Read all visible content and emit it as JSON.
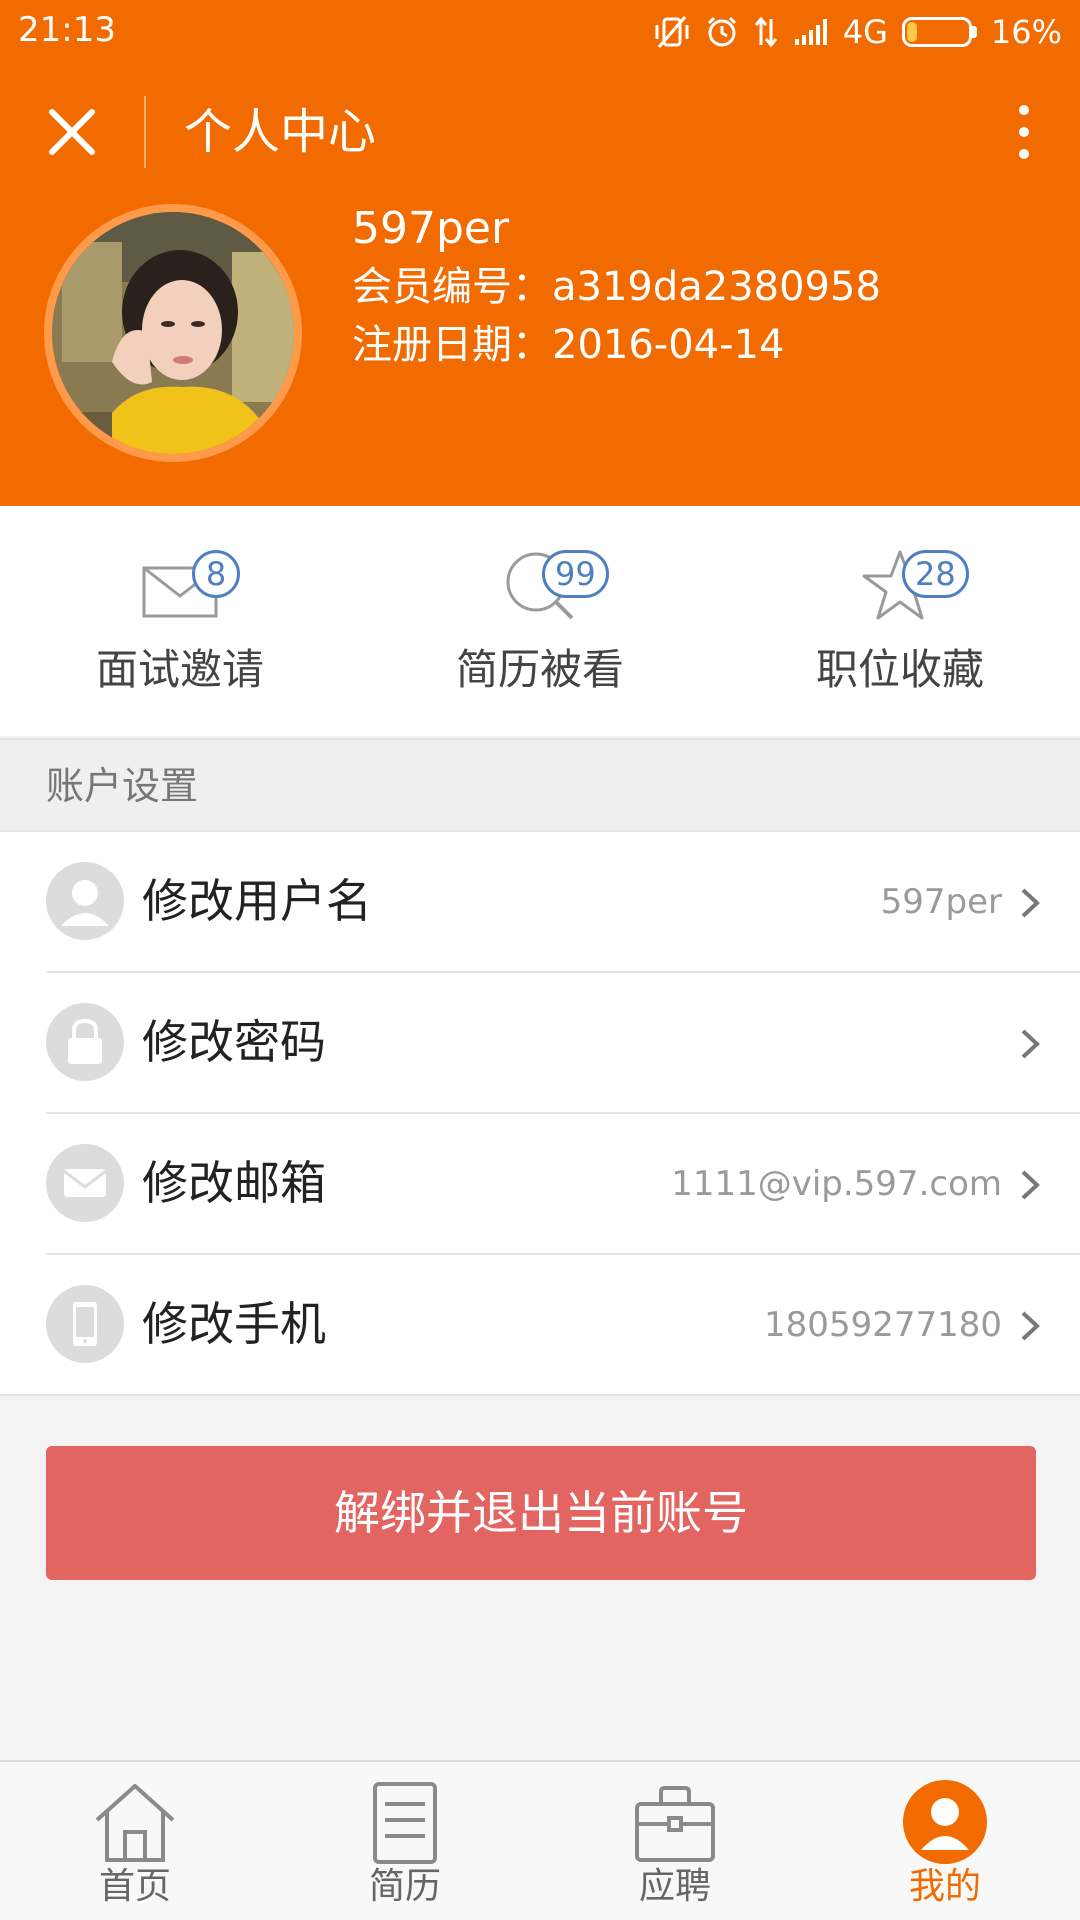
{
  "status_bar": {
    "time": "21:13",
    "network": "4G",
    "battery": "16%",
    "battery_level": 0.16
  },
  "app_bar": {
    "title": "个人中心"
  },
  "profile": {
    "username": "597per",
    "member_id_line": "会员编号：a319da2380958",
    "register_date_line": "注册日期：2016-04-14"
  },
  "stats": [
    {
      "label": "面试邀请",
      "count": "8",
      "icon": "envelope-icon"
    },
    {
      "label": "简历被看",
      "count": "99",
      "icon": "search-icon"
    },
    {
      "label": "职位收藏",
      "count": "28",
      "icon": "star-icon"
    }
  ],
  "account_section": {
    "title": "账户设置"
  },
  "settings": [
    {
      "label": "修改用户名",
      "value": "597per",
      "icon": "user-icon"
    },
    {
      "label": "修改密码",
      "value": "",
      "icon": "lock-icon"
    },
    {
      "label": "修改邮箱",
      "value": "1111@vip.597.com",
      "icon": "mail-icon"
    },
    {
      "label": "修改手机",
      "value": "18059277180",
      "icon": "phone-icon"
    }
  ],
  "logout_button": "解绑并退出当前账号",
  "tabs": [
    {
      "label": "首页",
      "icon": "home-icon",
      "active": false
    },
    {
      "label": "简历",
      "icon": "resume-icon",
      "active": false
    },
    {
      "label": "应聘",
      "icon": "briefcase-icon",
      "active": false
    },
    {
      "label": "我的",
      "icon": "profile-icon",
      "active": true
    }
  ],
  "colors": {
    "primary_orange": "#f26b00",
    "badge_blue": "#4e7fc0",
    "logout_red": "#e36562",
    "active_tab": "#f26b00"
  }
}
